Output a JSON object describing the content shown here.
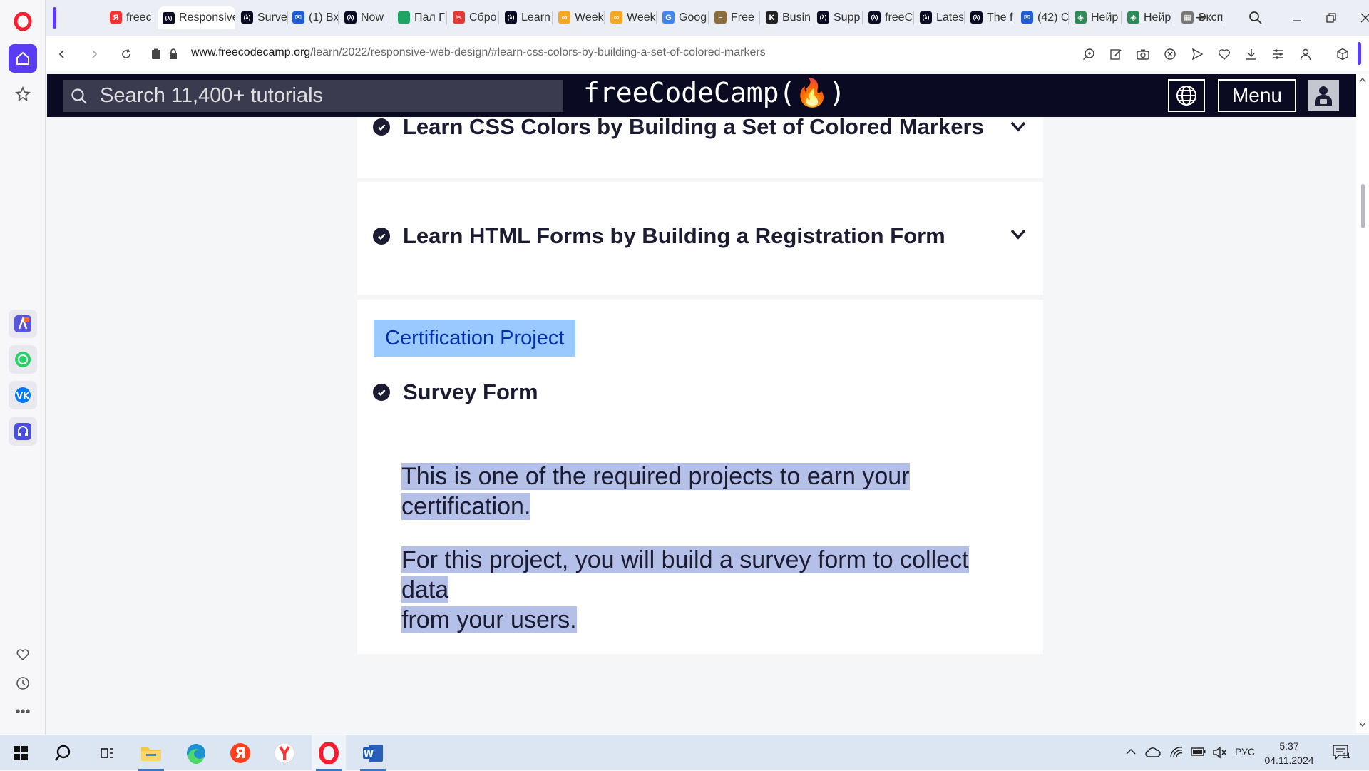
{
  "browser": {
    "tabs": [
      {
        "label": "freec",
        "favicon": "yandex-icon",
        "color": "#f33"
      },
      {
        "label": "Responsive",
        "favicon": "fcc-icon",
        "color": "#0a0a23"
      },
      {
        "label": "Surve",
        "favicon": "fcc-icon",
        "color": "#0a0a23"
      },
      {
        "label": "(1) Вх",
        "favicon": "mail-icon",
        "color": "#1e5bd6"
      },
      {
        "label": "Now",
        "favicon": "fcc-icon",
        "color": "#0a0a23"
      },
      {
        "label": "Пал Г",
        "favicon": "sheet-icon",
        "color": "#1fa463"
      },
      {
        "label": "Сбро",
        "favicon": "scissors-icon",
        "color": "#e53935"
      },
      {
        "label": "Learn",
        "favicon": "fcc-icon",
        "color": "#0a0a23"
      },
      {
        "label": "Week",
        "favicon": "infinity-icon",
        "color": "#f5a623"
      },
      {
        "label": "Week",
        "favicon": "infinity-icon",
        "color": "#f5a623"
      },
      {
        "label": "Goog",
        "favicon": "google-icon",
        "color": "#4285f4"
      },
      {
        "label": "Free",
        "favicon": "lines-icon",
        "color": "#8a6d3b"
      },
      {
        "label": "Busin",
        "favicon": "k-icon",
        "color": "#222"
      },
      {
        "label": "Supp",
        "favicon": "fcc-icon",
        "color": "#0a0a23"
      },
      {
        "label": "freeC",
        "favicon": "fcc-icon",
        "color": "#0a0a23"
      },
      {
        "label": "Lates",
        "favicon": "fcc-icon",
        "color": "#0a0a23"
      },
      {
        "label": "The f",
        "favicon": "fcc-icon",
        "color": "#0a0a23"
      },
      {
        "label": "(42) С",
        "favicon": "mail-icon",
        "color": "#1e5bd6"
      },
      {
        "label": "Нейр",
        "favicon": "cube-icon",
        "color": "#2e8b57"
      },
      {
        "label": "Нейр",
        "favicon": "cube-icon",
        "color": "#2e8b57"
      },
      {
        "label": "Эксп",
        "favicon": "grid-icon",
        "color": "#777"
      }
    ],
    "url_domain": "www.freecodecamp.org",
    "url_path": "/learn/2022/responsive-web-design/#learn-css-colors-by-building-a-set-of-colored-markers"
  },
  "site": {
    "search_placeholder": "Search 11,400+ tutorials",
    "brand": "freeCodeCamp(🔥)",
    "menu_label": "Menu"
  },
  "content": {
    "blocks": [
      {
        "title": "Learn CSS Colors by Building a Set of Colored Markers",
        "completed": true
      },
      {
        "title": "Learn HTML Forms by Building a Registration Form",
        "completed": true
      }
    ],
    "certification": {
      "badge": "Certification Project",
      "project_title": "Survey Form",
      "completed": true,
      "desc1_line1": "This is one of the required projects to earn your",
      "desc1_line2": "certification.",
      "desc2_line1": "For this project, you will build a survey form to collect data",
      "desc2_line2": "from your users."
    }
  },
  "taskbar": {
    "time": "5:37",
    "date": "04.11.2024",
    "lang": "РУС",
    "notifications": "11"
  }
}
